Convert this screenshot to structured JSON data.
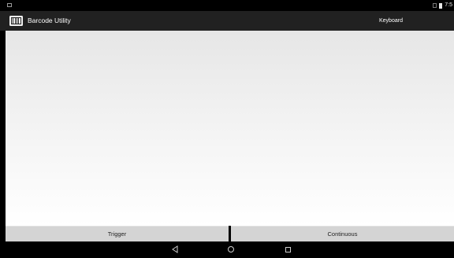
{
  "status_bar": {
    "time": "7:5",
    "icons": [
      "notification-icon",
      "signal-icon",
      "battery-icon"
    ]
  },
  "app_bar": {
    "title": "Barcode Utility",
    "action_label": "Keyboard",
    "icon": "barcode-icon"
  },
  "buttons": {
    "trigger_label": "Trigger",
    "continuous_label": "Continuous"
  },
  "nav_bar": {
    "icons": [
      "back-icon",
      "home-icon",
      "recents-icon"
    ]
  },
  "colors": {
    "app_bar": "#212121",
    "button": "#d4d4d4",
    "content_top": "#e6e6e6",
    "content_bottom": "#ffffff"
  }
}
